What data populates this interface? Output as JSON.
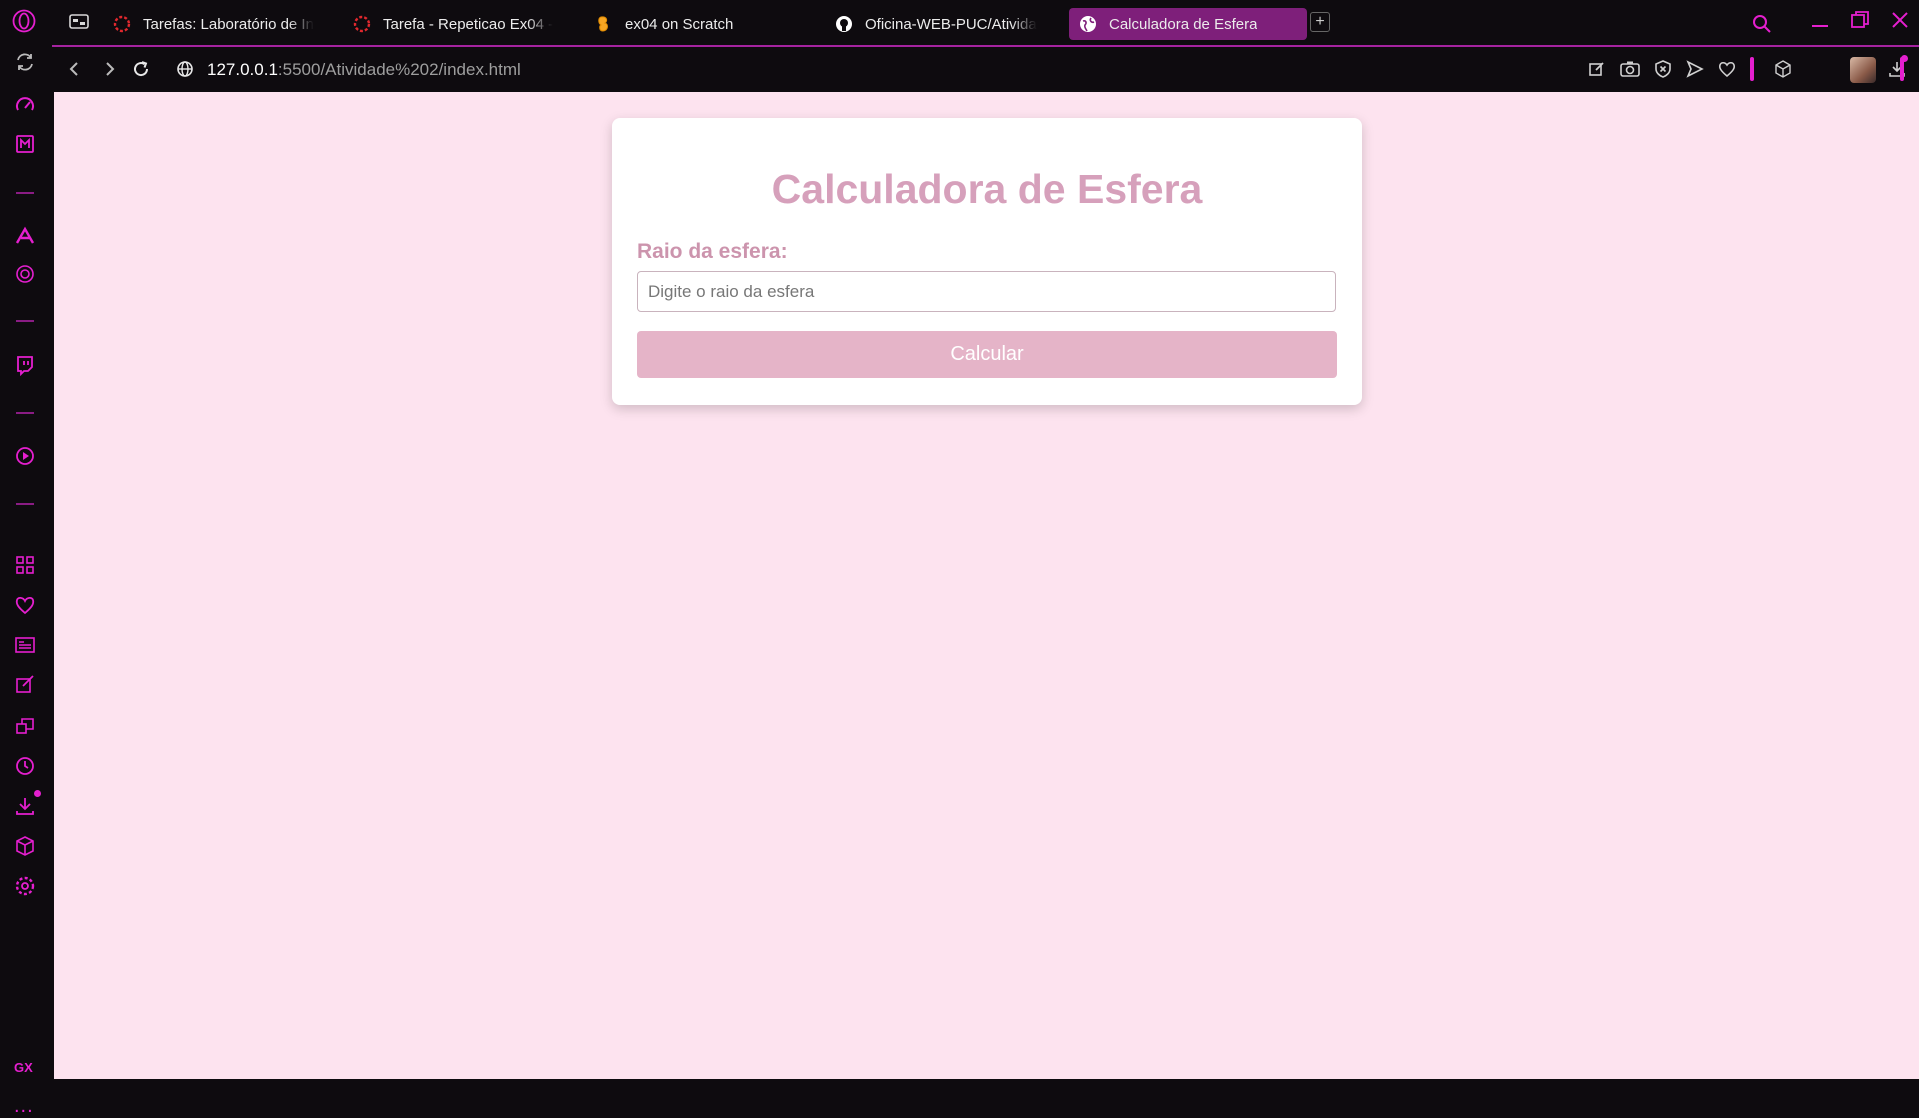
{
  "browser": {
    "tabs": [
      {
        "label": "Tarefas: Laboratório de In",
        "icon": "canvas-logo-icon"
      },
      {
        "label": "Tarefa - Repeticao Ex04 -",
        "icon": "canvas-logo-icon"
      },
      {
        "label": "ex04 on Scratch",
        "icon": "scratch-logo-icon"
      },
      {
        "label": "Oficina-WEB-PUC/Ativida",
        "icon": "github-icon"
      },
      {
        "label": "Calculadora de Esfera",
        "icon": "globe-icon",
        "active": true
      }
    ],
    "new_tab_label": "+",
    "address": {
      "host": "127.0.0.1",
      "path": ":5500/Atividade%202/index.html"
    },
    "sidebar": {
      "gx_label": "GX",
      "more_label": "..."
    },
    "accent_color": "#e51fcf"
  },
  "page": {
    "title": "Calculadora de Esfera",
    "radius_label": "Raio da esfera:",
    "radius_input": {
      "value": "",
      "placeholder": "Digite o raio da esfera"
    },
    "calculate_button": "Calcular",
    "colors": {
      "background": "#fde3ef",
      "title": "#d6a0bb",
      "label": "#cc94ad",
      "button": "#e5b4c8"
    }
  }
}
